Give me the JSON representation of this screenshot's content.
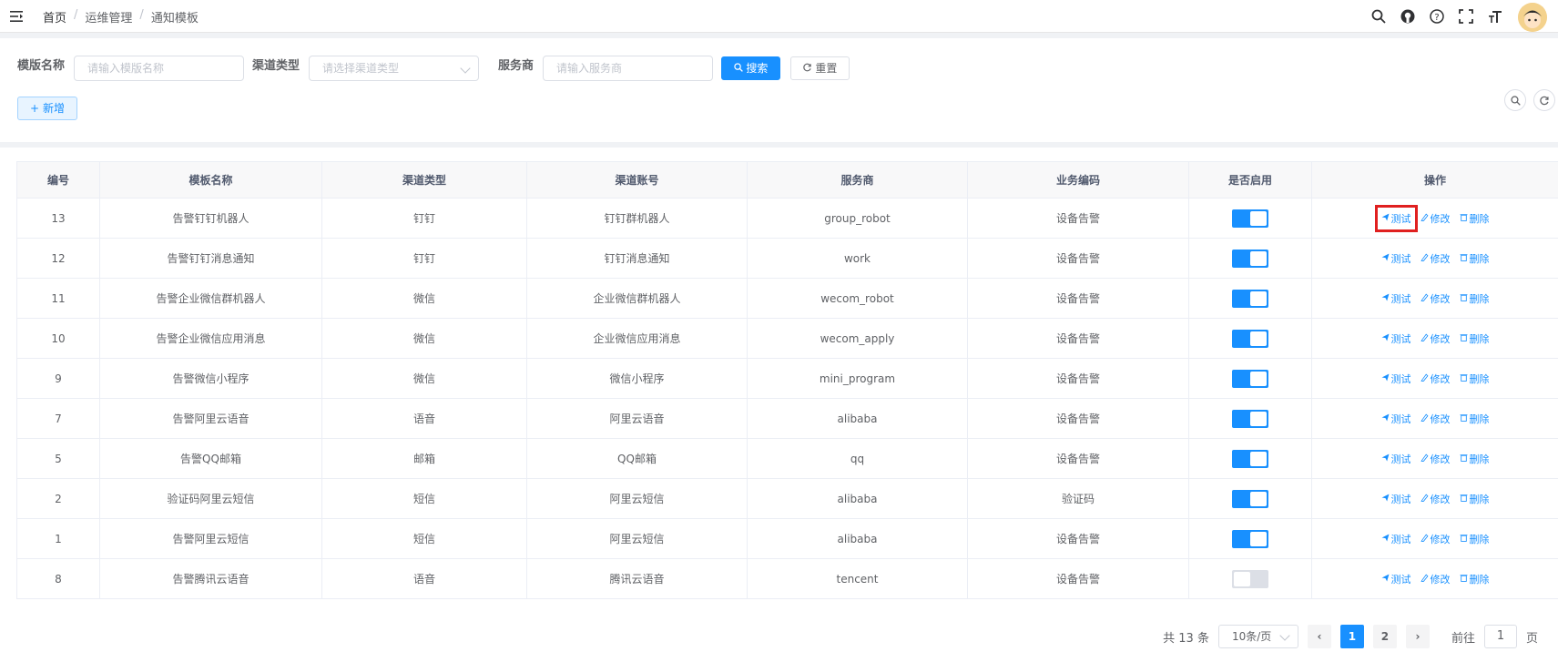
{
  "breadcrumb": [
    "首页",
    "运维管理",
    "通知模板"
  ],
  "breadcrumb_sep": "/",
  "search": {
    "template_name_label": "模版名称",
    "template_name_placeholder": "请输入模版名称",
    "channel_type_label": "渠道类型",
    "channel_type_placeholder": "请选择渠道类型",
    "provider_label": "服务商",
    "provider_placeholder": "请输入服务商",
    "search_button": "搜索",
    "reset_button": "重置"
  },
  "toolbar": {
    "add_button": "新增"
  },
  "table": {
    "columns": [
      "编号",
      "模板名称",
      "渠道类型",
      "渠道账号",
      "服务商",
      "业务编码",
      "是否启用",
      "操作"
    ],
    "rows": [
      {
        "id": "13",
        "name": "告警钉钉机器人",
        "channel": "钉钉",
        "account": "钉钉群机器人",
        "provider": "group_robot",
        "code": "设备告警",
        "enabled": true
      },
      {
        "id": "12",
        "name": "告警钉钉消息通知",
        "channel": "钉钉",
        "account": "钉钉消息通知",
        "provider": "work",
        "code": "设备告警",
        "enabled": true
      },
      {
        "id": "11",
        "name": "告警企业微信群机器人",
        "channel": "微信",
        "account": "企业微信群机器人",
        "provider": "wecom_robot",
        "code": "设备告警",
        "enabled": true
      },
      {
        "id": "10",
        "name": "告警企业微信应用消息",
        "channel": "微信",
        "account": "企业微信应用消息",
        "provider": "wecom_apply",
        "code": "设备告警",
        "enabled": true
      },
      {
        "id": "9",
        "name": "告警微信小程序",
        "channel": "微信",
        "account": "微信小程序",
        "provider": "mini_program",
        "code": "设备告警",
        "enabled": true
      },
      {
        "id": "7",
        "name": "告警阿里云语音",
        "channel": "语音",
        "account": "阿里云语音",
        "provider": "alibaba",
        "code": "设备告警",
        "enabled": true
      },
      {
        "id": "5",
        "name": "告警QQ邮箱",
        "channel": "邮箱",
        "account": "QQ邮箱",
        "provider": "qq",
        "code": "设备告警",
        "enabled": true
      },
      {
        "id": "2",
        "name": "验证码阿里云短信",
        "channel": "短信",
        "account": "阿里云短信",
        "provider": "alibaba",
        "code": "验证码",
        "enabled": true
      },
      {
        "id": "1",
        "name": "告警阿里云短信",
        "channel": "短信",
        "account": "阿里云短信",
        "provider": "alibaba",
        "code": "设备告警",
        "enabled": true
      },
      {
        "id": "8",
        "name": "告警腾讯云语音",
        "channel": "语音",
        "account": "腾讯云语音",
        "provider": "tencent",
        "code": "设备告警",
        "enabled": false
      }
    ],
    "actions": {
      "test": "测试",
      "edit": "修改",
      "delete": "删除"
    }
  },
  "pagination": {
    "total": "共 13 条",
    "page_size": "10条/页",
    "pages": [
      "1",
      "2"
    ],
    "current": "1",
    "goto_label": "前往",
    "goto_value": "1",
    "page_suffix": "页"
  },
  "colors": {
    "primary": "#1890ff",
    "highlight": "#e02020"
  }
}
